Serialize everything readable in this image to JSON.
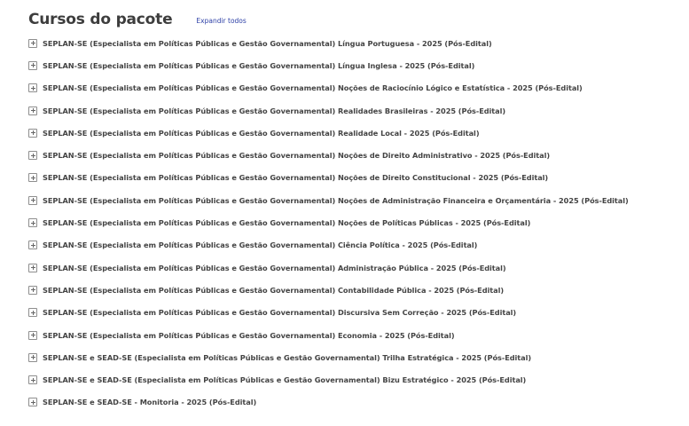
{
  "header": {
    "title": "Cursos do pacote",
    "expand_all_label": "Expandir todos"
  },
  "courses": [
    {
      "label": "SEPLAN-SE (Especialista em Políticas Públicas e Gestão Governamental) Língua Portuguesa - 2025 (Pós-Edital)"
    },
    {
      "label": "SEPLAN-SE (Especialista em Políticas Públicas e Gestão Governamental) Língua Inglesa - 2025 (Pós-Edital)"
    },
    {
      "label": "SEPLAN-SE (Especialista em Políticas Públicas e Gestão Governamental) Noções de Raciocínio Lógico e Estatística - 2025 (Pós-Edital)"
    },
    {
      "label": "SEPLAN-SE (Especialista em Políticas Públicas e Gestão Governamental) Realidades Brasileiras - 2025 (Pós-Edital)"
    },
    {
      "label": "SEPLAN-SE (Especialista em Políticas Públicas e Gestão Governamental) Realidade Local - 2025 (Pós-Edital)"
    },
    {
      "label": "SEPLAN-SE (Especialista em Políticas Públicas e Gestão Governamental) Noções de Direito Administrativo - 2025 (Pós-Edital)"
    },
    {
      "label": "SEPLAN-SE (Especialista em Políticas Públicas e Gestão Governamental) Noções de Direito Constitucional - 2025 (Pós-Edital)"
    },
    {
      "label": "SEPLAN-SE (Especialista em Políticas Públicas e Gestão Governamental) Noções de Administração Financeira e Orçamentária - 2025 (Pós-Edital)"
    },
    {
      "label": "SEPLAN-SE (Especialista em Políticas Públicas e Gestão Governamental) Noções de Políticas Públicas - 2025 (Pós-Edital)"
    },
    {
      "label": "SEPLAN-SE (Especialista em Políticas Públicas e Gestão Governamental) Ciência Política - 2025 (Pós-Edital)"
    },
    {
      "label": "SEPLAN-SE (Especialista em Políticas Públicas e Gestão Governamental) Administração Pública - 2025 (Pós-Edital)"
    },
    {
      "label": "SEPLAN-SE (Especialista em Políticas Públicas e Gestão Governamental) Contabilidade Pública - 2025 (Pós-Edital)"
    },
    {
      "label": "SEPLAN-SE (Especialista em Políticas Públicas e Gestão Governamental) Discursiva Sem Correção - 2025 (Pós-Edital)"
    },
    {
      "label": "SEPLAN-SE (Especialista em Políticas Públicas e Gestão Governamental) Economia - 2025 (Pós-Edital)"
    },
    {
      "label": "SEPLAN-SE e SEAD-SE (Especialista em Políticas Públicas e Gestão Governamental) Trilha Estratégica - 2025 (Pós-Edital)"
    },
    {
      "label": "SEPLAN-SE e SEAD-SE (Especialista em Políticas Públicas e Gestão Governamental) Bizu Estratégico - 2025 (Pós-Edital)"
    },
    {
      "label": "SEPLAN-SE e SEAD-SE - Monitoria - 2025 (Pós-Edital)"
    }
  ],
  "icons": {
    "expand_toggle": "plus-square-icon"
  },
  "colors": {
    "title": "#3d3d3d",
    "link": "#2c3fa6",
    "text": "#444444"
  }
}
